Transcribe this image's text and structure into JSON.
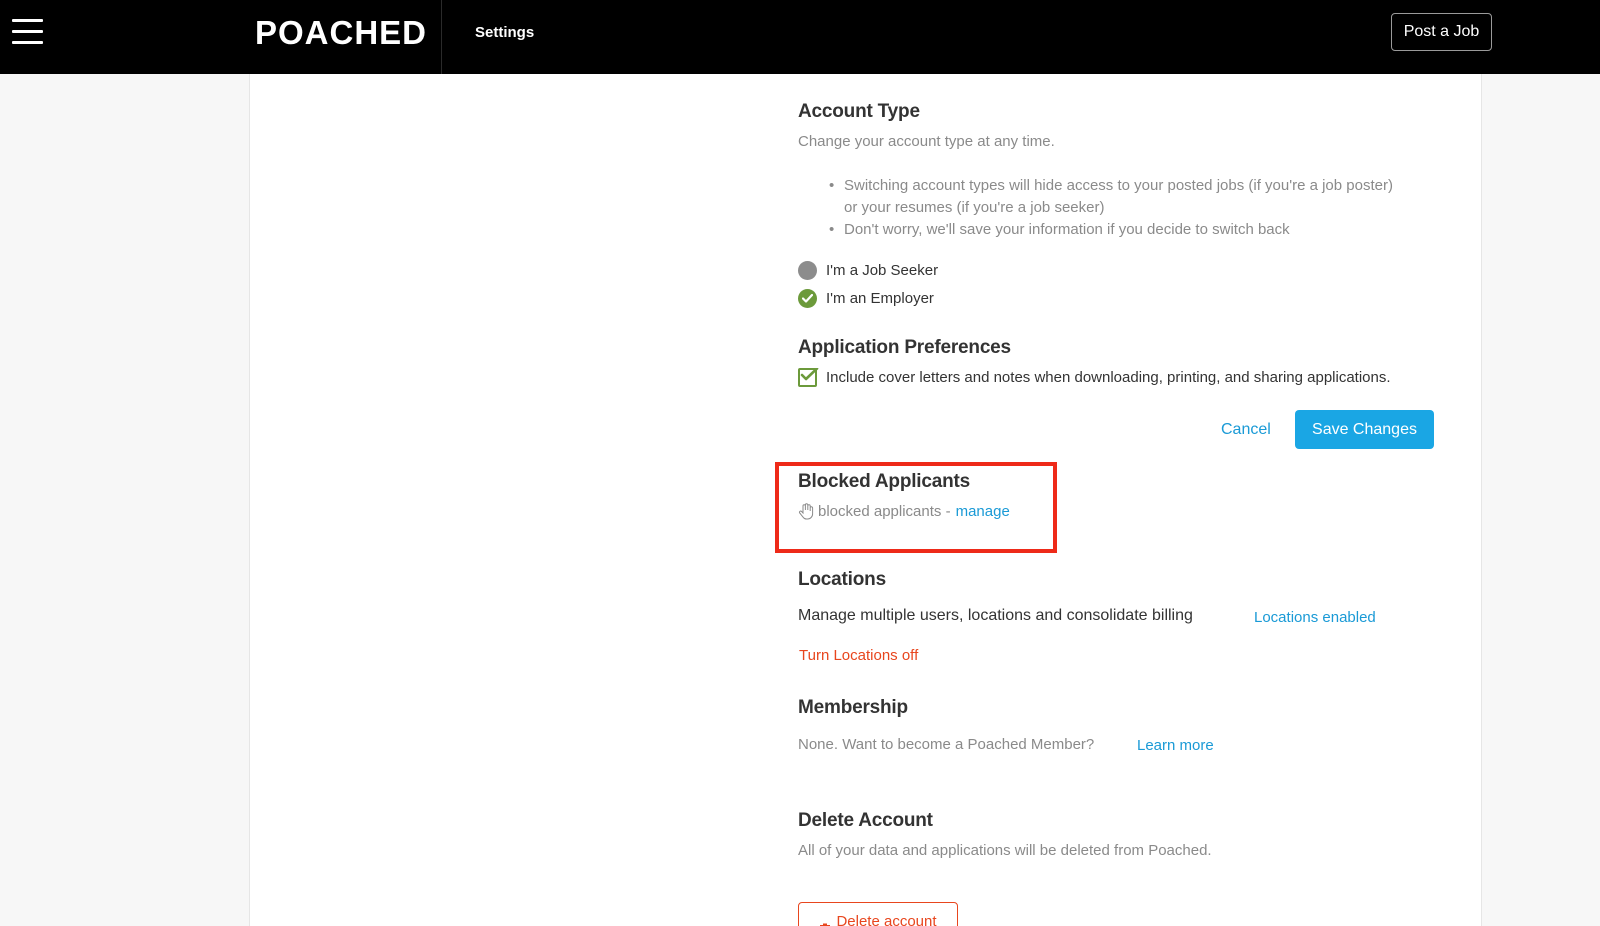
{
  "header": {
    "logo": "POACHED",
    "page_title": "Settings",
    "post_job_label": "Post a Job"
  },
  "account_type": {
    "title": "Account Type",
    "subtitle": "Change your account type at any time.",
    "bullets": [
      "Switching account types will hide access to your posted jobs (if you're a job poster)",
      "or your resumes (if you're a job seeker)",
      "Don't worry, we'll save your information if you decide to switch back"
    ],
    "options": [
      {
        "label": "I'm a Job Seeker",
        "selected": false
      },
      {
        "label": "I'm an Employer",
        "selected": true
      }
    ]
  },
  "application_preferences": {
    "title": "Application Preferences",
    "checkbox_label": "Include cover letters and notes when downloading, printing, and sharing applications.",
    "checked": true
  },
  "actions": {
    "cancel_label": "Cancel",
    "save_label": "Save Changes"
  },
  "blocked_applicants": {
    "title": "Blocked Applicants",
    "text": "blocked applicants -",
    "manage_label": "manage"
  },
  "locations": {
    "title": "Locations",
    "description": "Manage multiple users, locations and consolidate billing",
    "status_label": "Locations enabled",
    "turn_off_label": "Turn Locations off"
  },
  "membership": {
    "title": "Membership",
    "text": "None. Want to become a Poached Member?",
    "learn_more_label": "Learn more"
  },
  "delete_account": {
    "title": "Delete Account",
    "description": "All of your data and applications will be deleted from Poached.",
    "button_label": "Delete account"
  },
  "colors": {
    "accent_blue": "#1aa6e4",
    "link_blue": "#1a9ad6",
    "danger_orange": "#e8461e",
    "success_green": "#6c9a3b",
    "highlight_red": "#ee2a19"
  },
  "icons": [
    "hamburger-menu-icon",
    "checkmark-icon",
    "hand-icon",
    "trash-icon"
  ]
}
